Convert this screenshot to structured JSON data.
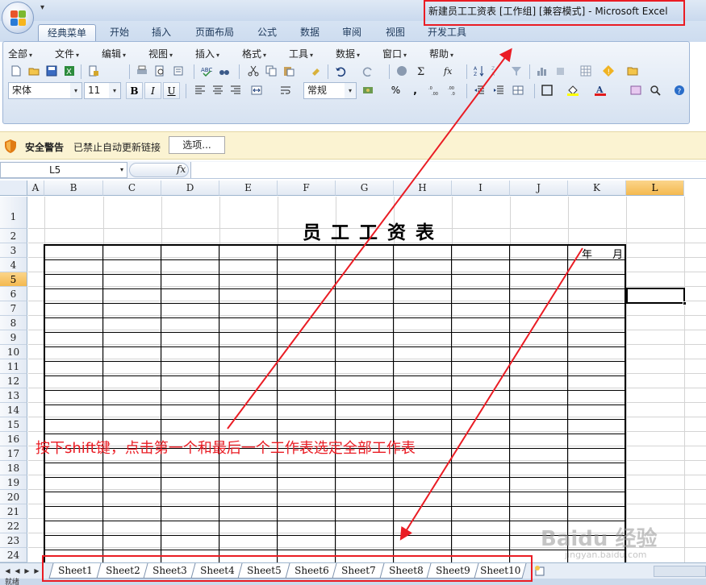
{
  "window": {
    "title": "新建员工工资表  [工作组]  [兼容模式] - Microsoft Excel",
    "qat_symbol": "▾"
  },
  "ribbon_tabs": [
    "经典菜单",
    "开始",
    "插入",
    "页面布局",
    "公式",
    "数据",
    "审阅",
    "视图",
    "开发工具"
  ],
  "menu_bar": [
    "全部",
    "文件",
    "编辑",
    "视图",
    "插入",
    "格式",
    "工具",
    "数据",
    "窗口",
    "帮助"
  ],
  "toolbar": {
    "font_name": "宋体",
    "font_size": "11",
    "bold": "B",
    "italic": "I",
    "underline": "U",
    "number_format": "常规",
    "percent": "%",
    "comma": ",",
    "font_color_letter": "A"
  },
  "security_bar": {
    "title": "安全警告",
    "message": "已禁止自动更新链接",
    "options_button": "选项..."
  },
  "formula_bar": {
    "name_box": "L5",
    "fx_label": "fx",
    "formula": ""
  },
  "columns": [
    "A",
    "B",
    "C",
    "D",
    "E",
    "F",
    "G",
    "H",
    "I",
    "J",
    "K",
    "L"
  ],
  "selected_column": "L",
  "rows": [
    "1",
    "2",
    "3",
    "4",
    "5",
    "6",
    "7",
    "8",
    "9",
    "10",
    "11",
    "12",
    "13",
    "14",
    "15",
    "16",
    "17",
    "18",
    "19",
    "20",
    "21",
    "22",
    "23",
    "24"
  ],
  "selected_row": "5",
  "active_cell": "L5",
  "sheet": {
    "title": "员工工资表",
    "year_label": "年",
    "month_label": "月"
  },
  "sheet_tabs": [
    "Sheet1",
    "Sheet2",
    "Sheet3",
    "Sheet4",
    "Sheet5",
    "Sheet6",
    "Sheet7",
    "Sheet8",
    "Sheet9",
    "Sheet10"
  ],
  "annotation": {
    "note": "按下shift键，点击第一个和最后一个工作表选定全部工作表",
    "color": "#ea1c24"
  },
  "watermark": {
    "text": "Baidu 经验",
    "sub": "jingyan.baidu.com"
  },
  "status_bar": {
    "text": "就绪"
  }
}
